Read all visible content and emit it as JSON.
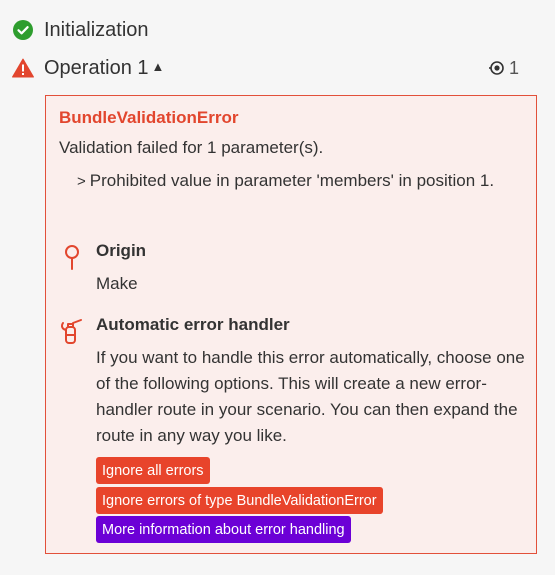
{
  "steps": [
    {
      "label": "Initialization",
      "status": "success",
      "icon": "check-circle-icon"
    },
    {
      "label": "Operation 1",
      "status": "warning",
      "icon": "warning-triangle-icon",
      "operations_count": "1"
    }
  ],
  "error": {
    "title": "BundleValidationError",
    "message": "Validation failed for 1 parameter(s).",
    "detail": "Prohibited value in parameter 'members' in position 1."
  },
  "origin": {
    "title": "Origin",
    "value": "Make",
    "icon": "pin-icon"
  },
  "handler": {
    "title": "Automatic error handler",
    "description": "If you want to handle this error automatically, choose one of the following options. This will create a new error-handler route in your scenario. You can then expand the route in any way you like.",
    "icon": "fire-extinguisher-icon",
    "buttons": [
      {
        "label": "Ignore all errors",
        "color": "#e8442b"
      },
      {
        "label": "Ignore errors of type BundleValidationError",
        "color": "#e8442b"
      },
      {
        "label": "More information about error handling",
        "color": "#6c00d6"
      }
    ]
  },
  "colors": {
    "success": "#2e9d2e",
    "warning": "#e2462e",
    "panel_bg": "#fbeeec",
    "panel_border": "#e2503a"
  }
}
